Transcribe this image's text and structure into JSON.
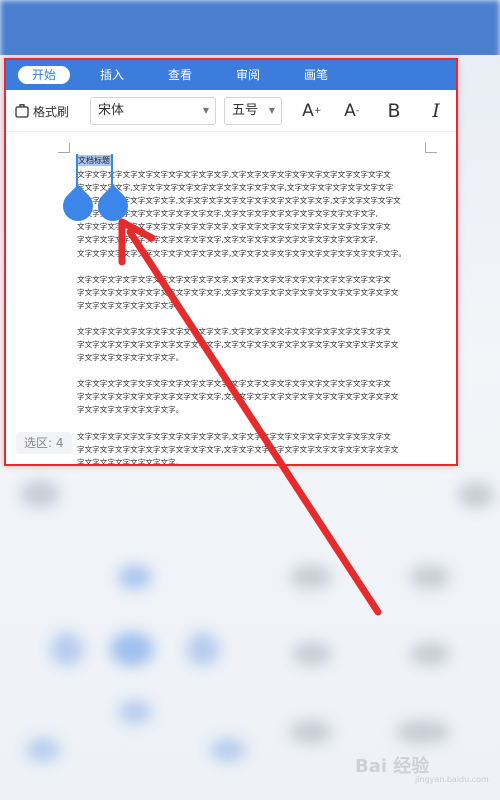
{
  "tabs": [
    {
      "label": "开始",
      "active": true
    },
    {
      "label": "插入",
      "active": false
    },
    {
      "label": "查看",
      "active": false
    },
    {
      "label": "审阅",
      "active": false
    },
    {
      "label": "画笔",
      "active": false
    }
  ],
  "toolbar": {
    "format_painter_label": "格式刷",
    "font_name": "宋体",
    "font_size": "五号",
    "grow_label": "A",
    "shrink_label": "A",
    "bold_label": "B",
    "italic_label": "I"
  },
  "document": {
    "title": "文档标题",
    "lines": [
      "文字文字文字文字文字文字文字文字文字文字,文字文字文字文字文字文字文字文字文字文字文",
      "字文字文字文字,文字文字文字文字文字文字文字文字文字文字,文字文字文字文字文字文字文字",
      "字文字文字文字文字文字文字,文字文字文字文字文字文字文字文字文字文字,文字文字文字文字文",
      "字文字文字文字文字文字文字文字文字文字,文字文字文字文字文字文字文字文字文字文字,",
      "文字文字文字文字文字文字文字文字文字文字,文字文字文字文字文字文字文字文字文字文字文",
      "字文字文字文字文字文字文字文字文字文字,文字文字文字文字文字文字文字文字文字文字,",
      "文字文字文字文字文字文字文字文字文字文字,文字文字文字文字文字文字文字文字文字文字文字。",
      "",
      "文字文字文字文字文字文字文字文字文字文字,文字文字文字文字文字文字文字文字文字文字文",
      "字文字文字文字文字文字文字文字文字文字,文字文字文字文字文字文字文字文字文字文字文字文",
      "字文字文字文字文字文字文字。",
      "",
      "文字文字文字文字文字文字文字文字文字文字,文字文字文字文字文字文字文字文字文字文字文",
      "字文字文字文字文字文字文字文字文字文字,文字文字文字文字文字文字文字文字文字文字文字文",
      "字文字文字文字文字文字文字。",
      "",
      "文字文字文字文字文字文字文字文字文字文字,文字文字文字文字文字文字文字文字文字文字文",
      "字文字文字文字文字文字文字文字文字文字,文字文字文字文字文字文字文字文字文字文字文字文",
      "字文字文字文字文字文字文字。",
      "",
      "文字文字文字文字文字文字文字文字文字文字,文字文字文字文字文字文字文字文字文字文字文",
      "字文字文字文字文字文字文字文字文字文字,文字文字文字文字文字文字文字文字文字文字文字文",
      "字文字文字文字文字文字文字。"
    ]
  },
  "selection_badge": "选区: 4",
  "watermark": "Bai 经验",
  "watermark_sub": "jingyan.baidu.com",
  "colors": {
    "accent": "#3c7cdd",
    "highlight_box": "#e52b2b",
    "arrow": "#e52b2b",
    "selection_handle": "#3b86e8"
  }
}
